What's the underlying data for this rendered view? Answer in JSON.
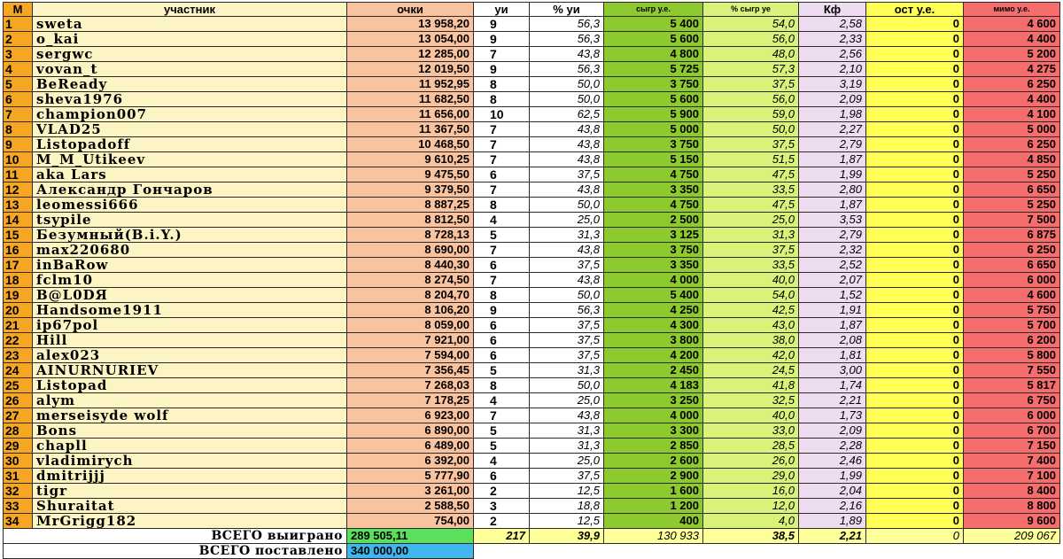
{
  "headers": {
    "m": "M",
    "name": "участник",
    "points": "очки",
    "ui": "уи",
    "pct_ui": "% уи",
    "played": "сыгр у.е.",
    "pct_played": "% сыгр уе",
    "kf": "Кф",
    "ost": "ост у.е.",
    "mimo": "мимо у.е."
  },
  "rows": [
    {
      "m": "1",
      "name": "sweta",
      "points": "13 958,20",
      "ui": "9",
      "pct_ui": "56,3",
      "played": "5 400",
      "pct_played": "54,0",
      "kf": "2,58",
      "ost": "0",
      "mimo": "4 600"
    },
    {
      "m": "2",
      "name": "o_kai",
      "points": "13 054,00",
      "ui": "9",
      "pct_ui": "56,3",
      "played": "5 600",
      "pct_played": "56,0",
      "kf": "2,33",
      "ost": "0",
      "mimo": "4 400"
    },
    {
      "m": "3",
      "name": "sergwc",
      "points": "12 285,00",
      "ui": "7",
      "pct_ui": "43,8",
      "played": "4 800",
      "pct_played": "48,0",
      "kf": "2,56",
      "ost": "0",
      "mimo": "5 200"
    },
    {
      "m": "4",
      "name": "vovan_t",
      "points": "12 019,50",
      "ui": "9",
      "pct_ui": "56,3",
      "played": "5 725",
      "pct_played": "57,3",
      "kf": "2,10",
      "ost": "0",
      "mimo": "4 275"
    },
    {
      "m": "5",
      "name": "BeReady",
      "points": "11 952,95",
      "ui": "8",
      "pct_ui": "50,0",
      "played": "3 750",
      "pct_played": "37,5",
      "kf": "3,19",
      "ost": "0",
      "mimo": "6 250"
    },
    {
      "m": "6",
      "name": "sheva1976",
      "points": "11 682,50",
      "ui": "8",
      "pct_ui": "50,0",
      "played": "5 600",
      "pct_played": "56,0",
      "kf": "2,09",
      "ost": "0",
      "mimo": "4 400"
    },
    {
      "m": "7",
      "name": "champion007",
      "points": "11 656,00",
      "ui": "10",
      "pct_ui": "62,5",
      "played": "5 900",
      "pct_played": "59,0",
      "kf": "1,98",
      "ost": "0",
      "mimo": "4 100"
    },
    {
      "m": "8",
      "name": "VLAD25",
      "points": "11 367,50",
      "ui": "7",
      "pct_ui": "43,8",
      "played": "5 000",
      "pct_played": "50,0",
      "kf": "2,27",
      "ost": "0",
      "mimo": "5 000"
    },
    {
      "m": "9",
      "name": "Listopadoff",
      "points": "10 468,50",
      "ui": "7",
      "pct_ui": "43,8",
      "played": "3 750",
      "pct_played": "37,5",
      "kf": "2,79",
      "ost": "0",
      "mimo": "6 250"
    },
    {
      "m": "10",
      "name": "M_M_Utikeev",
      "points": "9 610,25",
      "ui": "7",
      "pct_ui": "43,8",
      "played": "5 150",
      "pct_played": "51,5",
      "kf": "1,87",
      "ost": "0",
      "mimo": "4 850"
    },
    {
      "m": "11",
      "name": "aka Lars",
      "points": "9 475,50",
      "ui": "6",
      "pct_ui": "37,5",
      "played": "4 750",
      "pct_played": "47,5",
      "kf": "1,99",
      "ost": "0",
      "mimo": "5 250"
    },
    {
      "m": "12",
      "name": "Александр Гончаров",
      "points": "9 379,50",
      "ui": "7",
      "pct_ui": "43,8",
      "played": "3 350",
      "pct_played": "33,5",
      "kf": "2,80",
      "ost": "0",
      "mimo": "6 650"
    },
    {
      "m": "13",
      "name": "leomessi666",
      "points": "8 887,25",
      "ui": "8",
      "pct_ui": "50,0",
      "played": "4 750",
      "pct_played": "47,5",
      "kf": "1,87",
      "ost": "0",
      "mimo": "5 250"
    },
    {
      "m": "14",
      "name": "tsypile",
      "points": "8 812,50",
      "ui": "4",
      "pct_ui": "25,0",
      "played": "2 500",
      "pct_played": "25,0",
      "kf": "3,53",
      "ost": "0",
      "mimo": "7 500"
    },
    {
      "m": "15",
      "name": "Безумный(B.i.Y.)",
      "points": "8 728,13",
      "ui": "5",
      "pct_ui": "31,3",
      "played": "3 125",
      "pct_played": "31,3",
      "kf": "2,79",
      "ost": "0",
      "mimo": "6 875"
    },
    {
      "m": "16",
      "name": "max220680",
      "points": "8 690,00",
      "ui": "7",
      "pct_ui": "43,8",
      "played": "3 750",
      "pct_played": "37,5",
      "kf": "2,32",
      "ost": "0",
      "mimo": "6 250"
    },
    {
      "m": "17",
      "name": "inBaRow",
      "points": "8 440,30",
      "ui": "6",
      "pct_ui": "37,5",
      "played": "3 350",
      "pct_played": "33,5",
      "kf": "2,52",
      "ost": "0",
      "mimo": "6 650"
    },
    {
      "m": "18",
      "name": "fclm10",
      "points": "8 274,50",
      "ui": "7",
      "pct_ui": "43,8",
      "played": "4 000",
      "pct_played": "40,0",
      "kf": "2,07",
      "ost": "0",
      "mimo": "6 000"
    },
    {
      "m": "19",
      "name": "B@L0DЯ",
      "points": "8 204,70",
      "ui": "8",
      "pct_ui": "50,0",
      "played": "5 400",
      "pct_played": "54,0",
      "kf": "1,52",
      "ost": "0",
      "mimo": "4 600"
    },
    {
      "m": "20",
      "name": "Handsome1911",
      "points": "8 106,20",
      "ui": "9",
      "pct_ui": "56,3",
      "played": "4 250",
      "pct_played": "42,5",
      "kf": "1,91",
      "ost": "0",
      "mimo": "5 750"
    },
    {
      "m": "21",
      "name": "ip67pol",
      "points": "8 059,00",
      "ui": "6",
      "pct_ui": "37,5",
      "played": "4 300",
      "pct_played": "43,0",
      "kf": "1,87",
      "ost": "0",
      "mimo": "5 700"
    },
    {
      "m": "22",
      "name": "Hill",
      "points": "7 921,00",
      "ui": "6",
      "pct_ui": "37,5",
      "played": "3 800",
      "pct_played": "38,0",
      "kf": "2,08",
      "ost": "0",
      "mimo": "6 200"
    },
    {
      "m": "23",
      "name": "alex023",
      "points": "7 594,00",
      "ui": "6",
      "pct_ui": "37,5",
      "played": "4 200",
      "pct_played": "42,0",
      "kf": "1,81",
      "ost": "0",
      "mimo": "5 800"
    },
    {
      "m": "24",
      "name": "AINURNURIEV",
      "points": "7 356,45",
      "ui": "5",
      "pct_ui": "31,3",
      "played": "2 450",
      "pct_played": "24,5",
      "kf": "3,00",
      "ost": "0",
      "mimo": "7 550"
    },
    {
      "m": "25",
      "name": "Listopad",
      "points": "7 268,03",
      "ui": "8",
      "pct_ui": "50,0",
      "played": "4 183",
      "pct_played": "41,8",
      "kf": "1,74",
      "ost": "0",
      "mimo": "5 817"
    },
    {
      "m": "26",
      "name": "alym",
      "points": "7 178,25",
      "ui": "4",
      "pct_ui": "25,0",
      "played": "3 250",
      "pct_played": "32,5",
      "kf": "2,21",
      "ost": "0",
      "mimo": "6 750"
    },
    {
      "m": "27",
      "name": "merseisyde wolf",
      "points": "6 923,00",
      "ui": "7",
      "pct_ui": "43,8",
      "played": "4 000",
      "pct_played": "40,0",
      "kf": "1,73",
      "ost": "0",
      "mimo": "6 000"
    },
    {
      "m": "28",
      "name": "Bons",
      "points": "6 890,00",
      "ui": "5",
      "pct_ui": "31,3",
      "played": "3 300",
      "pct_played": "33,0",
      "kf": "2,09",
      "ost": "0",
      "mimo": "6 700"
    },
    {
      "m": "29",
      "name": "chapll",
      "points": "6 489,00",
      "ui": "5",
      "pct_ui": "31,3",
      "played": "2 850",
      "pct_played": "28,5",
      "kf": "2,28",
      "ost": "0",
      "mimo": "7 150"
    },
    {
      "m": "30",
      "name": "vladimirych",
      "points": "6 392,00",
      "ui": "4",
      "pct_ui": "25,0",
      "played": "2 600",
      "pct_played": "26,0",
      "kf": "2,46",
      "ost": "0",
      "mimo": "7 400"
    },
    {
      "m": "31",
      "name": "dmitrijjj",
      "points": "5 777,90",
      "ui": "6",
      "pct_ui": "37,5",
      "played": "2 900",
      "pct_played": "29,0",
      "kf": "1,99",
      "ost": "0",
      "mimo": "7 100"
    },
    {
      "m": "32",
      "name": "tigr",
      "points": "3 261,00",
      "ui": "2",
      "pct_ui": "12,5",
      "played": "1 600",
      "pct_played": "16,0",
      "kf": "2,04",
      "ost": "0",
      "mimo": "8 400"
    },
    {
      "m": "33",
      "name": "Shuraitat",
      "points": "2 588,50",
      "ui": "3",
      "pct_ui": "18,8",
      "played": "1 200",
      "pct_played": "12,0",
      "kf": "2,16",
      "ost": "0",
      "mimo": "8 800"
    },
    {
      "m": "34",
      "name": "MrGrigg182",
      "points": "754,00",
      "ui": "2",
      "pct_ui": "12,5",
      "played": "400",
      "pct_played": "4,0",
      "kf": "1,89",
      "ost": "0",
      "mimo": "9 600"
    }
  ],
  "totals": {
    "won_label": "ВСЕГО выиграно",
    "won_value": "289 505,11",
    "ui": "217",
    "pct_ui": "39,9",
    "played": "130 933",
    "pct_played": "38,5",
    "kf": "2,21",
    "ost": "0",
    "mimo": "209 067",
    "bet_label": "ВСЕГО поставлено",
    "bet_value": "340 000,00"
  },
  "colors": {
    "rank": "#f5a623",
    "name": "#fdf4c4",
    "points": "#fac3a0",
    "played": "#8ec92f",
    "pct_played": "#d9f27a",
    "kf": "#eedcf0",
    "ost": "#ffff55",
    "mimo": "#f56d6d",
    "total_won": "#5be05b",
    "total_bet": "#3fb7ee"
  }
}
